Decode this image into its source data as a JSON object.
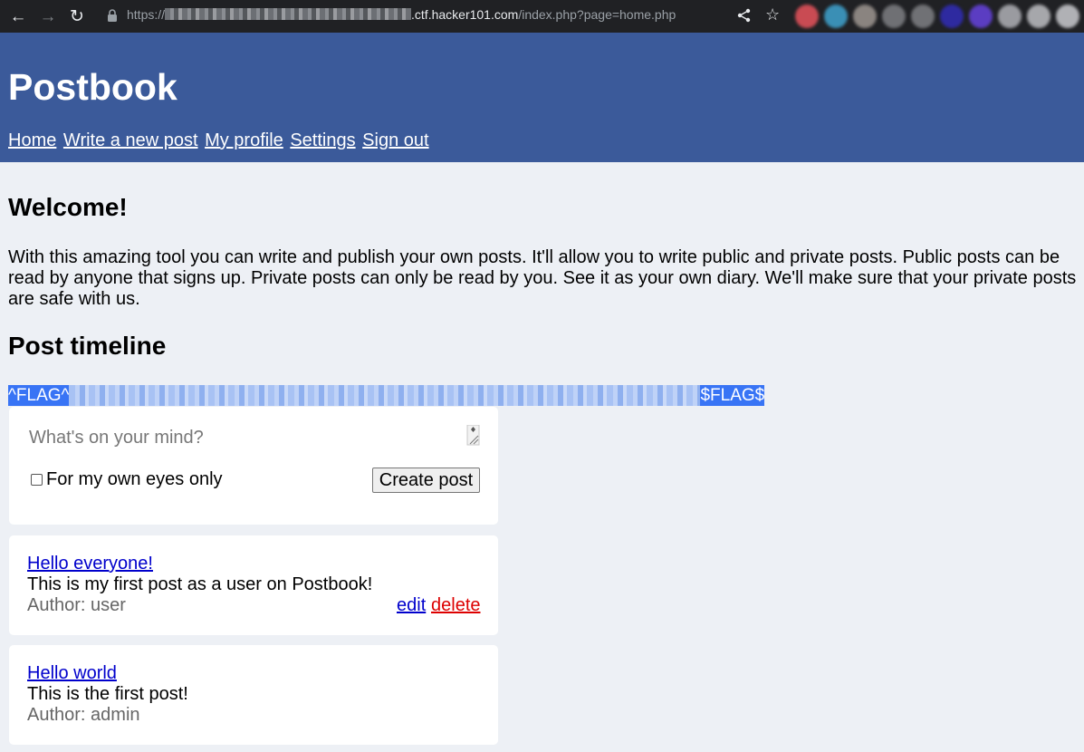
{
  "browser": {
    "url_scheme": "https://",
    "url_host": ".ctf.hacker101.com",
    "url_path": "/index.php?page=home.php",
    "extension_colors": [
      "#c94b53",
      "#3a8fb5",
      "#8a8480",
      "#6f7074",
      "#707175",
      "#2e2aa0",
      "#5b3dc2",
      "#9a9ba0",
      "#a6a7ab",
      "#b0b1b5"
    ]
  },
  "header": {
    "title": "Postbook",
    "nav": [
      "Home",
      "Write a new post",
      "My profile",
      "Settings",
      "Sign out"
    ]
  },
  "welcome": {
    "heading": "Welcome!",
    "text": "With this amazing tool you can write and publish your own posts. It'll allow you to write public and private posts. Public posts can be read by anyone that signs up. Private posts can only be read by you. See it as your own diary. We'll make sure that your private posts are safe with us."
  },
  "timeline": {
    "heading": "Post timeline",
    "flag_start": "^FLAG^",
    "flag_end": "$FLAG$"
  },
  "composer": {
    "placeholder": "What's on your mind?",
    "private_label": "For my own eyes only",
    "private_checked": false,
    "submit_label": "Create post"
  },
  "posts": [
    {
      "title": "Hello everyone!",
      "body": "This is my first post as a user on Postbook!",
      "author": "Author: user",
      "edit_label": "edit",
      "delete_label": "delete"
    },
    {
      "title": "Hello world",
      "body": "This is the first post!",
      "author": "Author: admin"
    }
  ],
  "colors": {
    "header_bg": "#3b5a9a",
    "page_bg": "#edf0f5",
    "flag_highlight": "#3874f5",
    "link": "#0000cc",
    "delete": "#dd0000"
  }
}
